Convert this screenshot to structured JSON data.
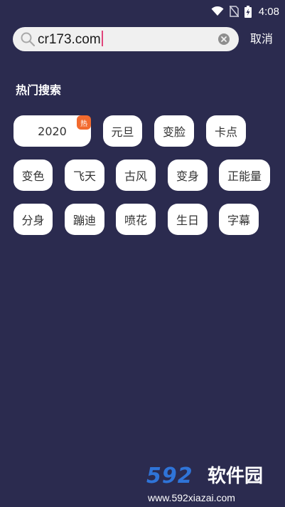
{
  "status_bar": {
    "time": "4:08",
    "icons": [
      "wifi-icon",
      "no-sim-icon",
      "battery-charging-icon"
    ]
  },
  "search": {
    "query": "cr173.com",
    "clear_icon": "clear-icon",
    "search_icon": "search-icon",
    "cancel_label": "取消"
  },
  "hot_search": {
    "title": "热门搜索",
    "tags": [
      {
        "label": "2020",
        "badge": "热"
      },
      {
        "label": "元旦"
      },
      {
        "label": "变脸"
      },
      {
        "label": "卡点"
      },
      {
        "label": "变色"
      },
      {
        "label": "飞天"
      },
      {
        "label": "古风"
      },
      {
        "label": "变身"
      },
      {
        "label": "正能量"
      },
      {
        "label": "分身"
      },
      {
        "label": "蹦迪"
      },
      {
        "label": "喷花"
      },
      {
        "label": "生日"
      },
      {
        "label": "字幕"
      }
    ]
  },
  "colors": {
    "background": "#2b2b4f",
    "tag_bg": "#ffffff",
    "badge": "#f26a2e",
    "caret": "#e0457b",
    "watermark_blue": "#2f74d8"
  },
  "watermark": {
    "logo_digits": "592",
    "logo_text": "软件园",
    "url": "www.592xiazai.com"
  }
}
